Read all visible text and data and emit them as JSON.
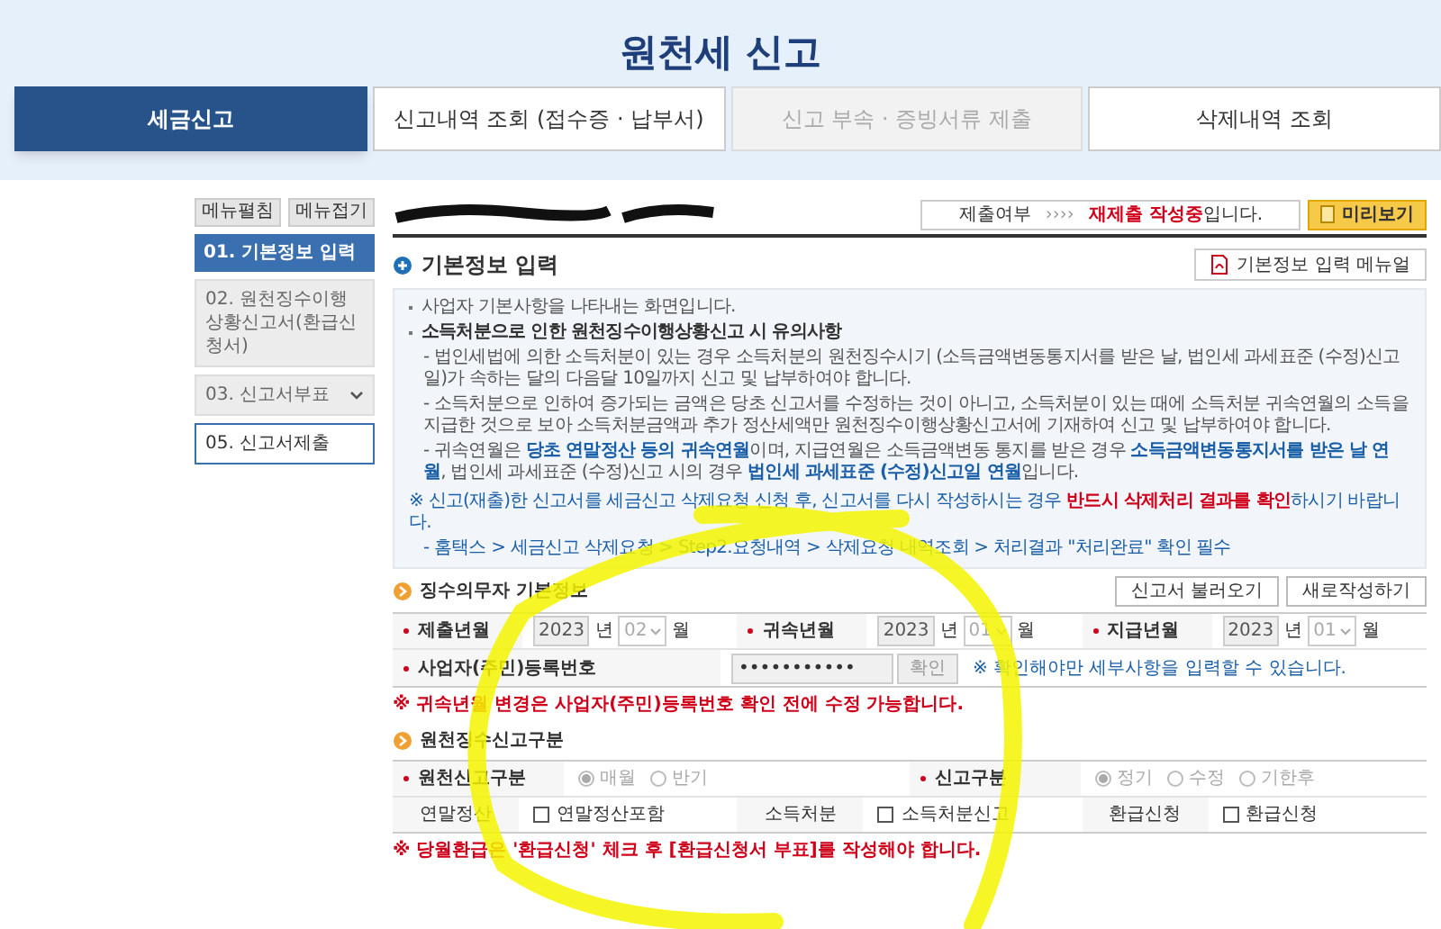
{
  "page_title": "원천세 신고",
  "tabs": [
    {
      "label": "세금신고",
      "selected": true,
      "disabled": false
    },
    {
      "label": "신고내역 조회 (접수증 · 납부서)",
      "selected": false,
      "disabled": false
    },
    {
      "label": "신고 부속 · 증빙서류 제출",
      "selected": false,
      "disabled": true
    },
    {
      "label": "삭제내역 조회",
      "selected": false,
      "disabled": false
    }
  ],
  "menu_buttons": [
    "메뉴펼침",
    "메뉴접기"
  ],
  "steps": [
    {
      "label": "01. 기본정보 입력",
      "selected": true,
      "kind": "plain"
    },
    {
      "label": "02. 원천징수이행상황신고서(환급신청서)",
      "selected": false,
      "kind": "plain"
    },
    {
      "label": "03. 신고서부표",
      "selected": false,
      "kind": "dropdown"
    },
    {
      "label": "05. 신고서제출",
      "selected": false,
      "kind": "outlined"
    }
  ],
  "status": {
    "label": "제출여부",
    "arrows": "››››",
    "message": "**재제출 작성중**입니다."
  },
  "preview_button": "미리보기",
  "section_title": "기본정보 입력",
  "manual_button": "기본정보 입력 메뉴얼",
  "notice": {
    "intro": "사업자 기본사항을 나타내는 화면입니다.",
    "heading": "소득처분으로 인한 원천징수이행상황신고 시 유의사항",
    "items": [
      "- 법인세법에 의한 소득처분이 있는 경우 소득처분의 원천징수시기 (소득금액변동통지서를 받은 날, 법인세 과세표준 (수정)신고일)가 속하는 달의 다음달 10일까지 신고 및 납부하여야 합니다.",
      "- 소득처분으로 인하여 증가되는 금액은 당초 신고서를 수정하는 것이 아니고, 소득처분이 있는 때에 소득처분 귀속연월의 소득을 지급한 것으로 보아 소득처분금액과 추가 정산세액만 원천징수이행상황신고서에 기재하여 신고 및 납부하여야 합니다.",
      "- 귀속연월은 **당초 연말정산 등의 귀속연월**이며, 지급연월은 소득금액변동 통지를 받은 경우 **소득금액변동통지서를 받은 날 연월**, 법인세 과세표준 (수정)신고 시의 경우 **법인세 과세표준 (수정)신고일 연월**입니다."
    ],
    "warning": "※ 신고(재출)한 신고서를 세금신고 삭제요청 신청 후, 신고서를 다시 작성하시는 경우 **반드시 삭제처리 결과를 확인**하시기 바랍니다.",
    "path": "- 홈택스 > 세금신고 삭제요청 > Step2.요청내역 > 삭제요청 내역조회 > 처리결과 \"처리완료\" 확인 필수"
  },
  "payer_section": {
    "title": "징수의무자 기본정보",
    "buttons": [
      "신고서 불러오기",
      "새로작성하기"
    ],
    "dates": [
      {
        "label": "제출년월",
        "year": "2023",
        "year_unit": "년",
        "month": "02",
        "month_unit": "월"
      },
      {
        "label": "귀속년월",
        "year": "2023",
        "year_unit": "년",
        "month": "01",
        "month_unit": "월"
      },
      {
        "label": "지급년월",
        "year": "2023",
        "year_unit": "년",
        "month": "01",
        "month_unit": "월"
      }
    ],
    "reg_label": "사업자(주민)등록번호",
    "reg_value": "•••••••••••",
    "confirm_button": "확인",
    "reg_hint": "※ 확인해야만 세부사항을 입력할 수 있습니다.",
    "note": "※ 귀속년월 변경은 사업자(주민)등록번호 확인 전에 수정 가능합니다."
  },
  "type_section": {
    "title": "원천징수신고구분",
    "radio_groups": [
      {
        "label": "원천신고구분",
        "options": [
          {
            "label": "매월",
            "selected": true
          },
          {
            "label": "반기",
            "selected": false
          }
        ]
      },
      {
        "label": "신고구분",
        "options": [
          {
            "label": "정기",
            "selected": true
          },
          {
            "label": "수정",
            "selected": false
          },
          {
            "label": "기한후",
            "selected": false
          }
        ]
      }
    ],
    "checks": [
      {
        "label": "연말정산",
        "option": "연말정산포함",
        "checked": false
      },
      {
        "label": "소득처분",
        "option": "소득처분신고",
        "checked": false
      },
      {
        "label": "환급신청",
        "option": "환급신청",
        "checked": false
      }
    ],
    "note": "※ 당월환급은 '환급신청' 체크 후 [환급신청서 부표]를 작성해야 합니다."
  }
}
